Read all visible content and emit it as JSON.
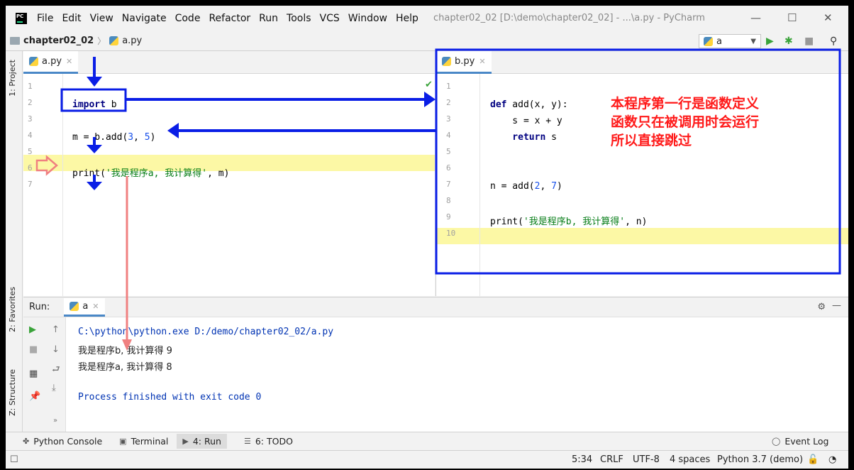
{
  "window": {
    "title": "chapter02_02 [D:\\demo\\chapter02_02] - ...\\a.py - PyCharm",
    "menu": [
      "File",
      "Edit",
      "View",
      "Navigate",
      "Code",
      "Refactor",
      "Run",
      "Tools",
      "VCS",
      "Window",
      "Help"
    ],
    "controls": {
      "minimize": "—",
      "maximize": "☐",
      "close": "✕"
    }
  },
  "navbar": {
    "project": "chapter02_02",
    "file": "a.py",
    "run_config": "a"
  },
  "sidebar": {
    "project_label": "1: Project",
    "favorites_label": "2: Favorites",
    "structure_label": "Z: Structure"
  },
  "editor_a": {
    "tab": "a.py",
    "lines": [
      "1",
      "2",
      "3",
      "4",
      "5",
      "6",
      "7"
    ],
    "code": {
      "l2_kw": "import",
      "l2_rest": " b",
      "l4_a": "m = b.add(",
      "l4_n1": "3",
      "l4_b": ", ",
      "l4_n2": "5",
      "l4_c": ")",
      "l6_a": "print(",
      "l6_str": "'我是程序a, 我计算得'",
      "l6_b": ", m)"
    }
  },
  "editor_b": {
    "tab": "b.py",
    "lines": [
      "1",
      "2",
      "3",
      "4",
      "5",
      "6",
      "7",
      "8",
      "9",
      "10"
    ],
    "code": {
      "l2_kw": "def",
      "l2_rest": " add(x, y):",
      "l3": "    s = x + y",
      "l4_kw": "    return",
      "l4_rest": " s",
      "l7_a": "n = add(",
      "l7_n1": "2",
      "l7_b": ", ",
      "l7_n2": "7",
      "l7_c": ")",
      "l9_a": "print(",
      "l9_str": "'我是程序b, 我计算得'",
      "l9_b": ", n)"
    }
  },
  "annotation": {
    "line1": "本程序第一行是函数定义",
    "line2": "函数只在被调用时会运行",
    "line3": "所以直接跳过"
  },
  "run_panel": {
    "label": "Run:",
    "tab": "a",
    "output": [
      "C:\\python\\python.exe D:/demo/chapter02_02/a.py",
      "我是程序b, 我计算得 9",
      "我是程序a, 我计算得 8",
      "",
      "Process finished with exit code 0"
    ]
  },
  "bottom_tabs": {
    "python_console": "Python Console",
    "terminal": "Terminal",
    "run": "4: Run",
    "todo": "6: TODO",
    "event_log": "Event Log"
  },
  "status": {
    "position": "5:34",
    "line_sep": "CRLF",
    "encoding": "UTF-8",
    "indent": "4 spaces",
    "interpreter": "Python 3.7 (demo)"
  },
  "colors": {
    "arrow_blue": "#0a1ee6",
    "arrow_red": "#f08080",
    "annotation_red": "#ff1a1a"
  }
}
